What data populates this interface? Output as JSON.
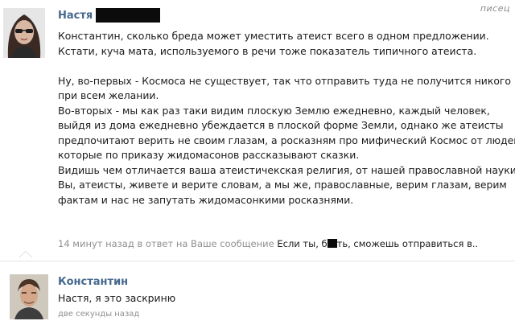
{
  "watermark": "писец",
  "post": {
    "author": "Настя",
    "lines": [
      "Константин, сколько бреда может уместить атеист всего в одном предложении.",
      "Кстати, куча мата, используемого в речи тоже показатель типичного атеиста.",
      "",
      "Ну, во-первых - Космоса не существует, так что отправить туда не получится никого",
      "при всем желании.",
      "Во-вторых - мы как раз таки видим плоскую Землю ежедневно, каждый человек,",
      "выйдя из дома ежедневно убеждается в плоской форме Земли, однако же атеисты",
      "предпочитают верить не своим глазам, а росказням про мифический Космос от людей,",
      "которые по приказу жидомасонов рассказывают сказки.",
      "Видишь чем отличается ваша атеистичекская религия, от нашей православной науки?",
      "Вы, атеисты, живете и верите словам, а мы же, православные, верим глазам, верим",
      "фактам и нас не запутать жидомасонкими росказнями."
    ],
    "time": "14 минут назад в ответ на Ваше сообщение",
    "snippet_before": "Если ты, б",
    "snippet_after": "ть, сможешь отправиться в.."
  },
  "reply": {
    "author": "Константин",
    "text": "Настя, я это заскриню",
    "time": "две секунды назад"
  }
}
